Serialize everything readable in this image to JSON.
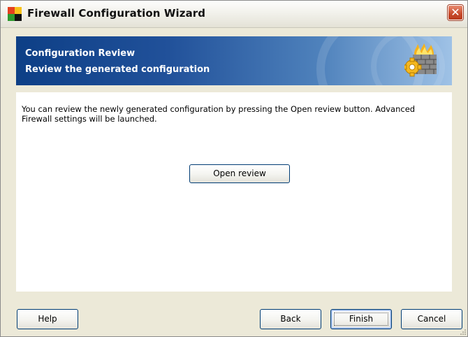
{
  "window": {
    "title": "Firewall Configuration Wizard",
    "close_icon": "close-icon",
    "logo_icon": "app-logo-icon"
  },
  "header": {
    "title": "Configuration Review",
    "subtitle": "Review the generated configuration",
    "icon": "firewall-gear-icon"
  },
  "content": {
    "description": "You can review the newly generated configuration by pressing the Open review button. Advanced Firewall settings will be launched.",
    "open_review_label": "Open review"
  },
  "footer": {
    "help_label": "Help",
    "back_label": "Back",
    "finish_label": "Finish",
    "cancel_label": "Cancel"
  },
  "colors": {
    "banner_start": "#0d3f86",
    "banner_end": "#9fc2e6",
    "close_button": "#c74a2b",
    "dialog_background": "#ece9d8"
  }
}
